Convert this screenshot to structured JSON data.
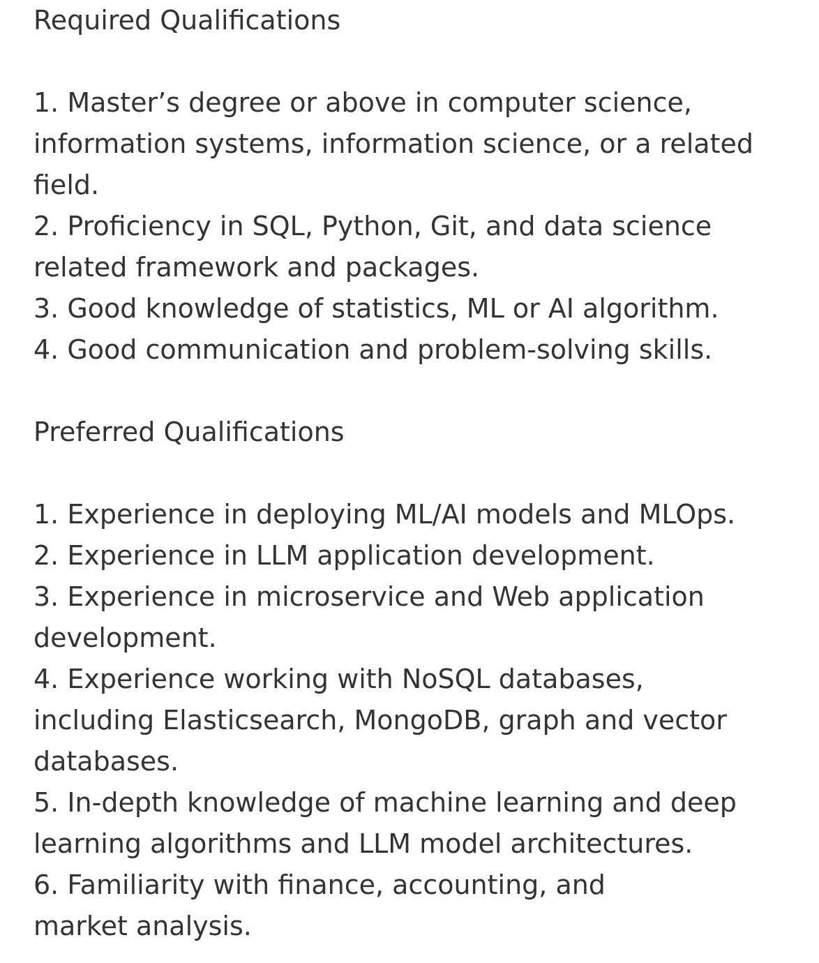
{
  "required": {
    "title": "Required Qualifications",
    "items": [
      {
        "line1": "1. Master’s degree or above in computer science,",
        "line2": "information systems, information science, or a related",
        "line3": "field."
      },
      {
        "line1": "2. Proficiency in SQL, Python, Git, and data science",
        "line2": "related framework and packages."
      },
      {
        "line1": "3. Good knowledge of statistics, ML or AI algorithm."
      },
      {
        "line1": "4. Good communication and problem-solving skills."
      }
    ]
  },
  "preferred": {
    "title": "Preferred Qualifications",
    "items": [
      {
        "line1": "1. Experience in deploying ML/AI models and MLOps."
      },
      {
        "line1": "2. Experience in LLM application development."
      },
      {
        "line1": "3. Experience in microservice and Web application",
        "line2": "development."
      },
      {
        "line1": "4. Experience working with NoSQL databases,",
        "line2": "including Elasticsearch, MongoDB, graph and vector",
        "line3": "databases."
      },
      {
        "line1": "5. In-depth knowledge of machine learning and deep",
        "line2": "learning algorithms and LLM model architectures."
      },
      {
        "line1": "6. Familiarity with finance, accounting, and",
        "line2": "market analysis."
      }
    ]
  }
}
